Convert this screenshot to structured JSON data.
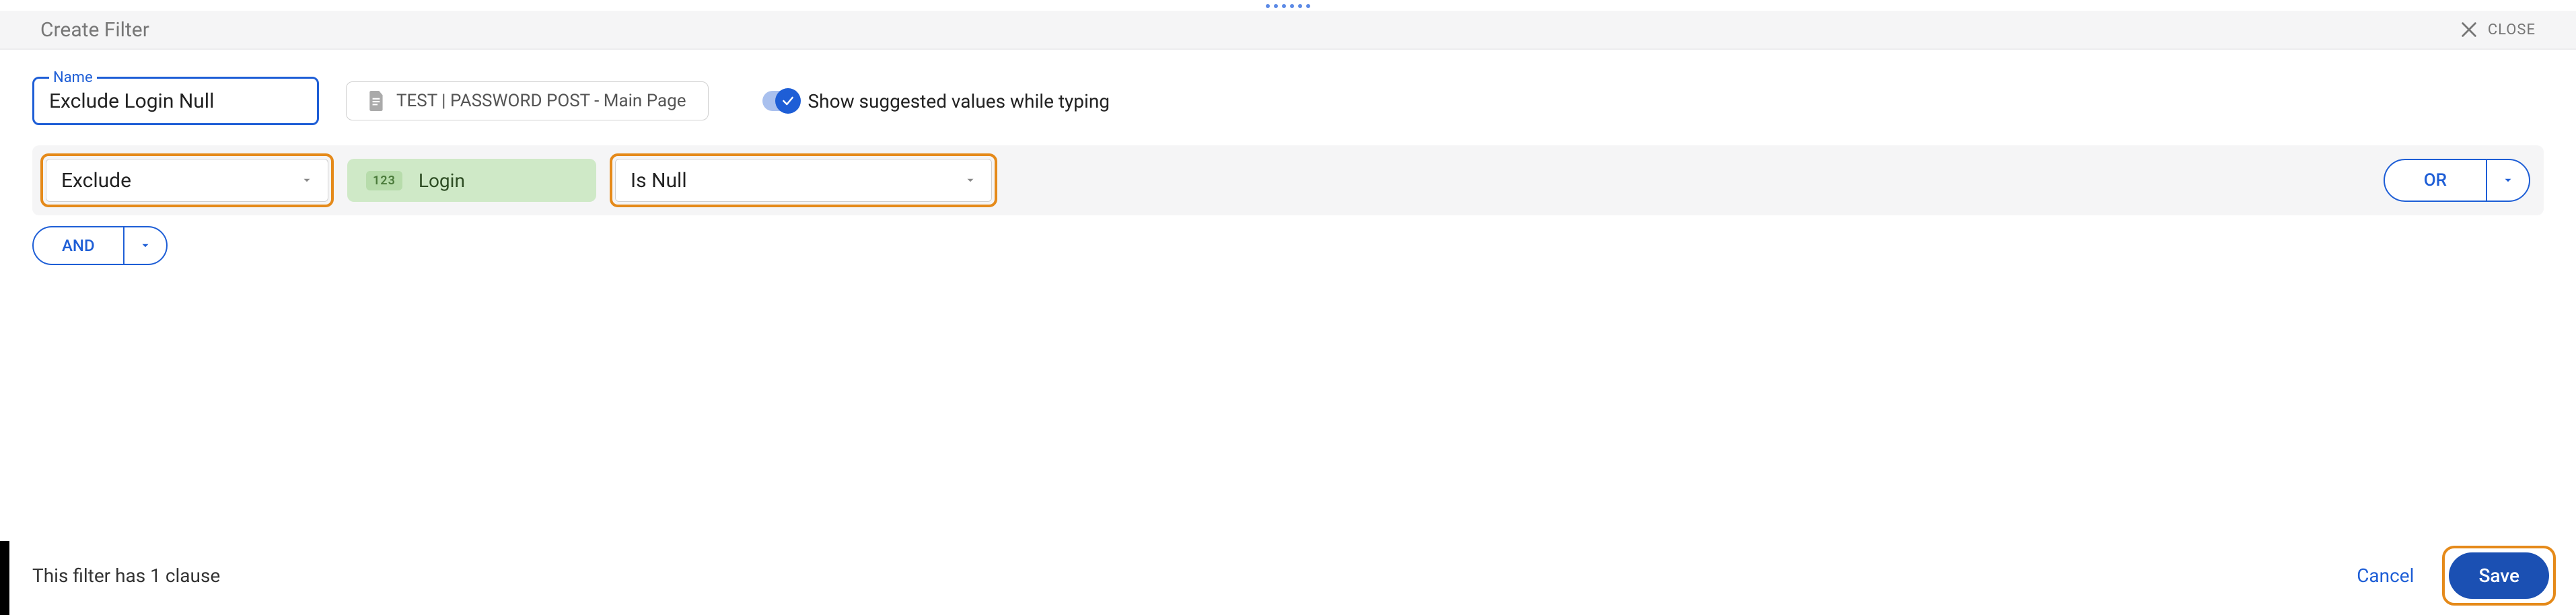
{
  "header": {
    "title": "Create Filter",
    "close_label": "CLOSE"
  },
  "name": {
    "label": "Name",
    "value": "Exclude Login Null"
  },
  "source": {
    "label": "TEST | PASSWORD POST - Main Page"
  },
  "suggest_toggle": {
    "label": "Show suggested values while typing",
    "on": true
  },
  "clause": {
    "action": "Exclude",
    "column": {
      "type_badge": "123",
      "name": "Login"
    },
    "condition": "Is Null",
    "or_label": "OR"
  },
  "and_label": "AND",
  "footer": {
    "count_text": "This filter has 1 clause",
    "cancel_label": "Cancel",
    "save_label": "Save"
  }
}
